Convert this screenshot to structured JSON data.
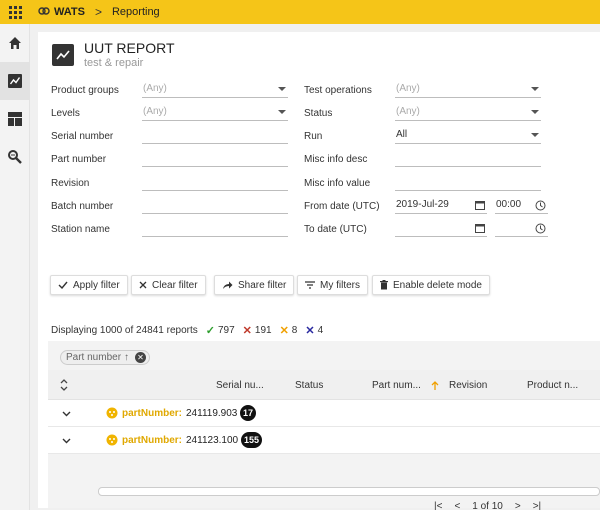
{
  "topbar": {
    "app_name": "WATS",
    "breadcrumb_sep": ">",
    "breadcrumb": "Reporting"
  },
  "header": {
    "title": "UUT REPORT",
    "subtitle": "test & repair"
  },
  "filters_left": [
    {
      "label": "Product groups",
      "value": "",
      "placeholder": "(Any)",
      "kind": "select"
    },
    {
      "label": "Levels",
      "value": "",
      "placeholder": "(Any)",
      "kind": "select"
    },
    {
      "label": "Serial number",
      "value": "",
      "placeholder": "",
      "kind": "text"
    },
    {
      "label": "Part number",
      "value": "",
      "placeholder": "",
      "kind": "text"
    },
    {
      "label": "Revision",
      "value": "",
      "placeholder": "",
      "kind": "text"
    },
    {
      "label": "Batch number",
      "value": "",
      "placeholder": "",
      "kind": "text"
    },
    {
      "label": "Station name",
      "value": "",
      "placeholder": "",
      "kind": "text"
    }
  ],
  "filters_right": [
    {
      "label": "Test operations",
      "value": "",
      "placeholder": "(Any)",
      "kind": "select"
    },
    {
      "label": "Status",
      "value": "",
      "placeholder": "(Any)",
      "kind": "select"
    },
    {
      "label": "Run",
      "value": "All",
      "placeholder": "",
      "kind": "select"
    },
    {
      "label": "Misc info desc",
      "value": "",
      "placeholder": "",
      "kind": "text"
    },
    {
      "label": "Misc info value",
      "value": "",
      "placeholder": "",
      "kind": "text"
    },
    {
      "label": "From date (UTC)",
      "date": "2019-Jul-29",
      "time": "00:00",
      "kind": "datetime"
    },
    {
      "label": "To date (UTC)",
      "date": "",
      "time": "",
      "kind": "datetime"
    }
  ],
  "buttons": {
    "apply": "Apply filter",
    "clear": "Clear filter",
    "share": "Share filter",
    "my_filters": "My filters",
    "delete_mode": "Enable delete mode"
  },
  "summary": {
    "text": "Displaying 1000 of 24841 reports",
    "passed": "797",
    "failed": "191",
    "error": "8",
    "terminated": "4",
    "colors": {
      "passed": "#2e9e2e",
      "failed": "#c0392b",
      "error": "#f0a000",
      "terminated": "#2a2aa0"
    }
  },
  "grid": {
    "group_chip": "Part number",
    "group_chip_arrow": "↑",
    "columns": [
      "Serial nu...",
      "Status",
      "Part num...",
      "Revision",
      "Product n..."
    ],
    "groups": [
      {
        "key": "partNumber:",
        "value": "241119.903",
        "count": "17"
      },
      {
        "key": "partNumber:",
        "value": "241123.100",
        "count": "155"
      }
    ]
  },
  "pager": {
    "first": "|<",
    "prev": "<",
    "info": "1 of 10",
    "next": ">",
    "last": ">|"
  },
  "accent_color": "#f5c518"
}
